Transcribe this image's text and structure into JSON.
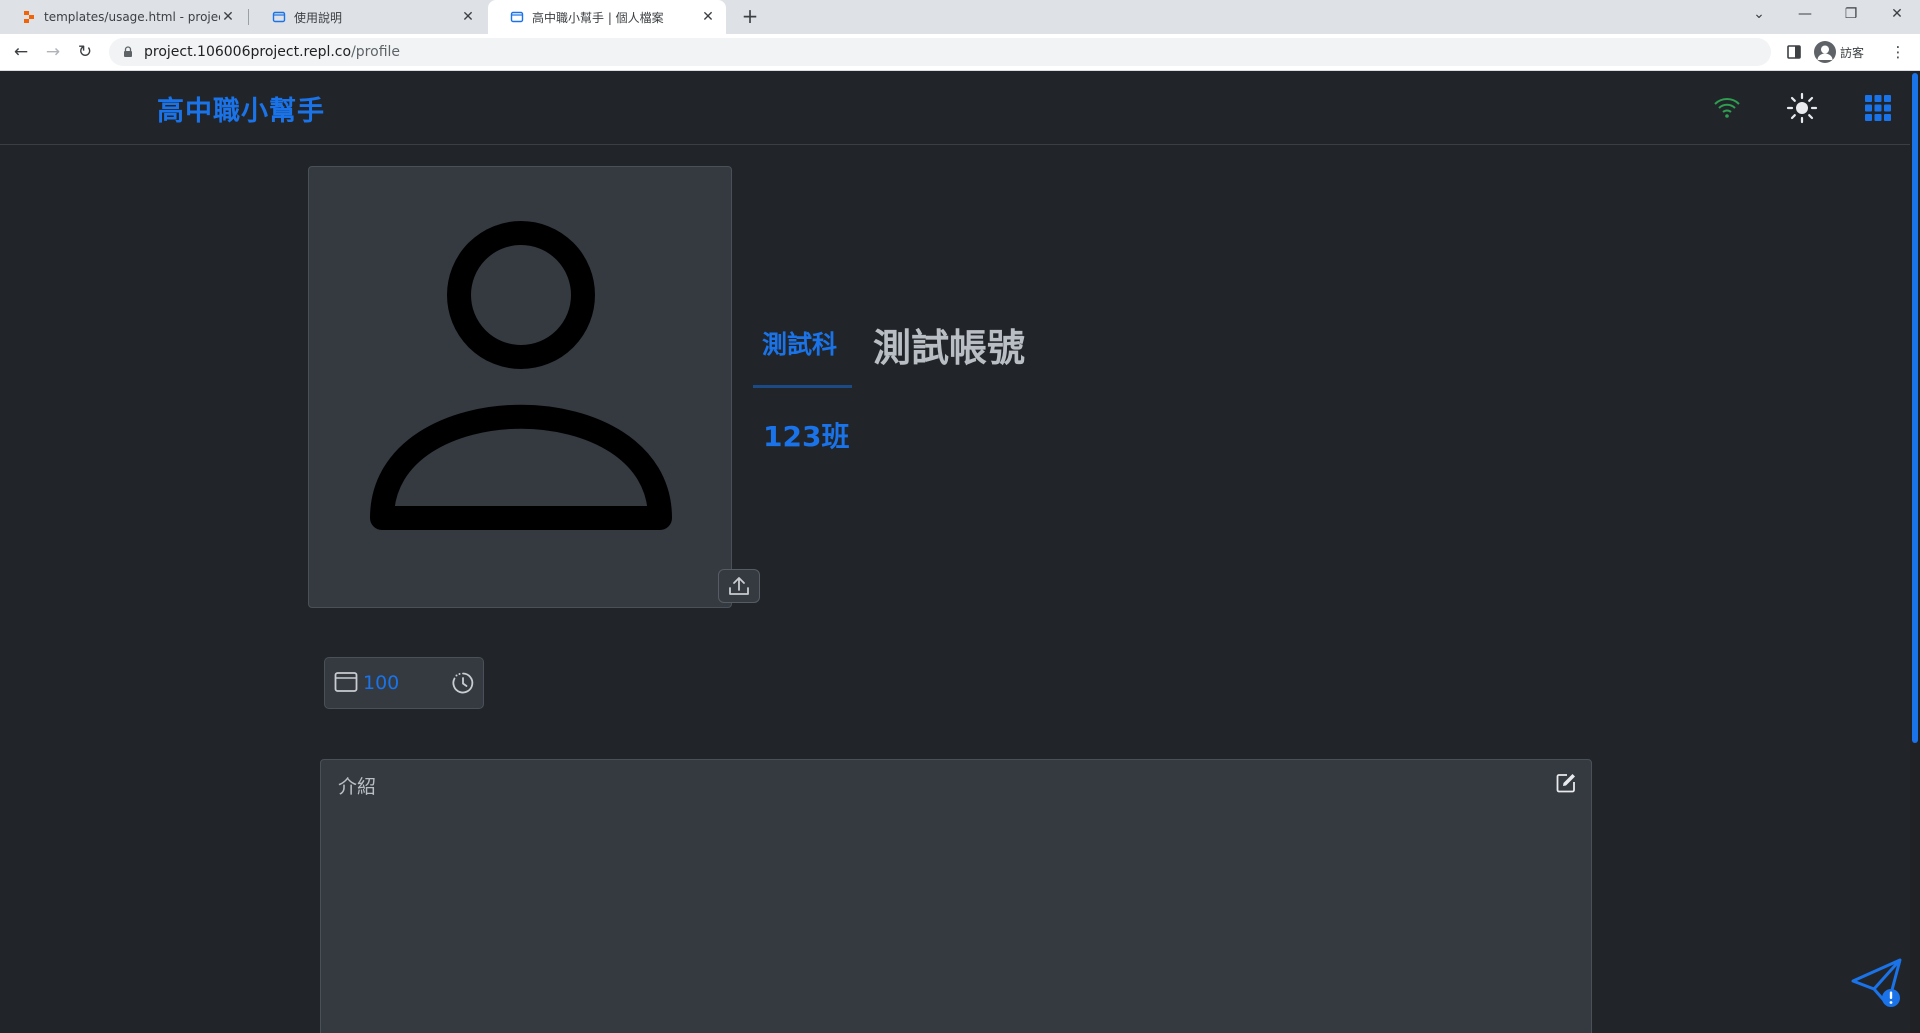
{
  "browser": {
    "tabs": [
      {
        "title": "templates/usage.html - project",
        "favicon": "replit-icon",
        "active": false
      },
      {
        "title": "使用說明",
        "favicon": "page-icon",
        "active": false
      },
      {
        "title": "高中職小幫手 | 個人檔案",
        "favicon": "page-icon",
        "active": true
      }
    ],
    "url_host": "project.106006project.repl.co",
    "url_path": "/profile",
    "profile_label": "訪客"
  },
  "navbar": {
    "brand": "高中職小幫手",
    "icons": [
      "wifi-icon",
      "sun-icon",
      "apps-grid-icon"
    ]
  },
  "profile": {
    "department": "測試科",
    "class_name": "123班",
    "username": "測試帳號",
    "points": "100"
  },
  "intro": {
    "label": "介紹"
  },
  "colors": {
    "accent": "#1a73e8",
    "page_bg": "#212529",
    "card_bg": "#343a40",
    "online": "#2e9e4f"
  }
}
